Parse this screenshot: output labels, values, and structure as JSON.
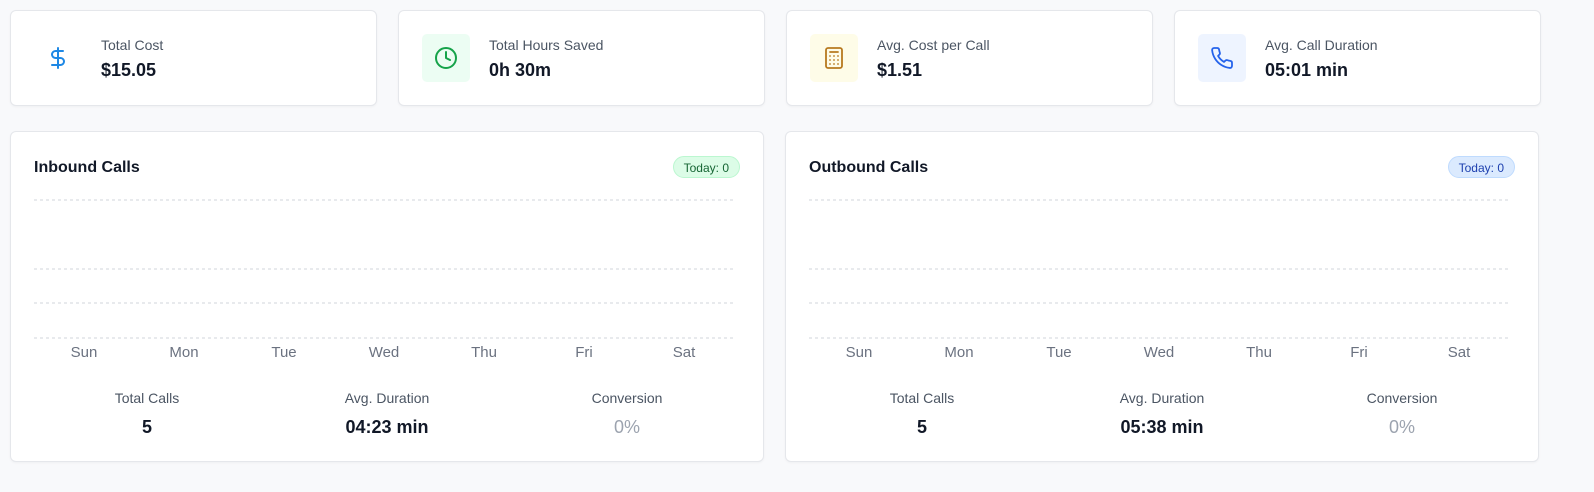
{
  "stats": [
    {
      "label": "Total Cost",
      "value": "$15.05",
      "icon": "dollar-icon",
      "icon_color": "#1e88e5",
      "icon_bg": "#ffffff"
    },
    {
      "label": "Total Hours Saved",
      "value": "0h 30m",
      "icon": "clock-icon",
      "icon_color": "#16a34a",
      "icon_bg": "#ecfdf3"
    },
    {
      "label": "Avg. Cost per Call",
      "value": "$1.51",
      "icon": "calculator-icon",
      "icon_color": "#b7791f",
      "icon_bg": "#fefce8"
    },
    {
      "label": "Avg. Call Duration",
      "value": "05:01 min",
      "icon": "phone-icon",
      "icon_color": "#2563eb",
      "icon_bg": "#eef4ff"
    }
  ],
  "inbound": {
    "title": "Inbound Calls",
    "badge": "Today: 0",
    "days": [
      "Sun",
      "Mon",
      "Tue",
      "Wed",
      "Thu",
      "Fri",
      "Sat"
    ],
    "metrics": [
      {
        "label": "Total Calls",
        "value": "5"
      },
      {
        "label": "Avg. Duration",
        "value": "04:23 min"
      },
      {
        "label": "Conversion",
        "value": "0%"
      }
    ]
  },
  "outbound": {
    "title": "Outbound Calls",
    "badge": "Today: 0",
    "days": [
      "Sun",
      "Mon",
      "Tue",
      "Wed",
      "Thu",
      "Fri",
      "Sat"
    ],
    "metrics": [
      {
        "label": "Total Calls",
        "value": "5"
      },
      {
        "label": "Avg. Duration",
        "value": "05:38 min"
      },
      {
        "label": "Conversion",
        "value": "0%"
      }
    ]
  }
}
